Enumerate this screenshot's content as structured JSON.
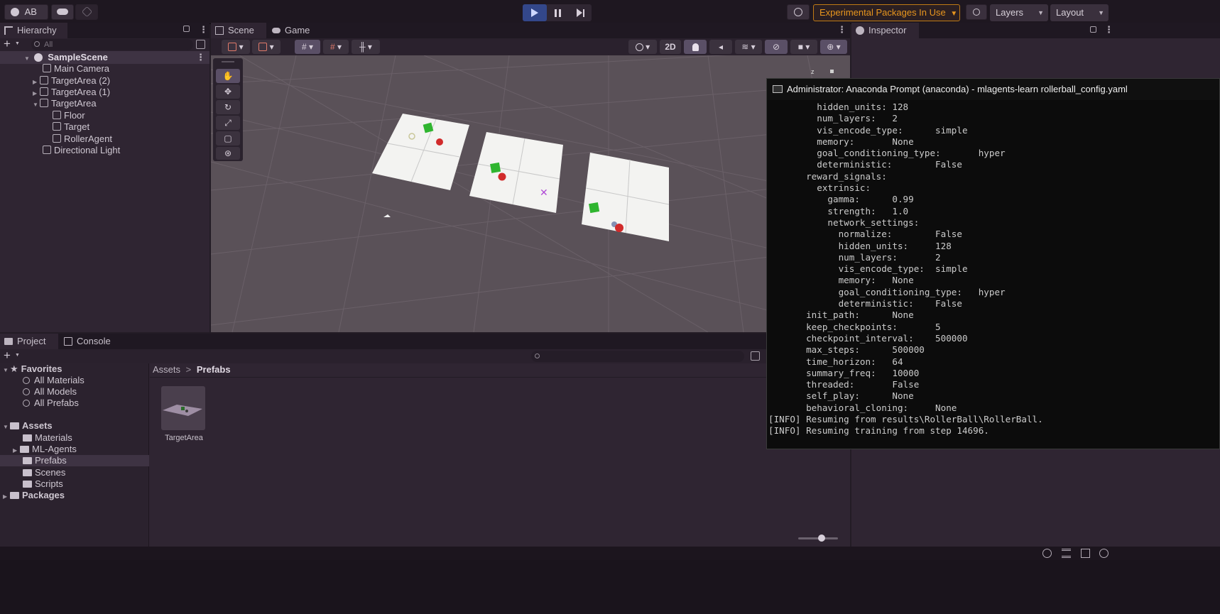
{
  "topbar": {
    "account_label": "AB",
    "experimental_label": "Experimental Packages In Use",
    "layers_label": "Layers",
    "layout_label": "Layout"
  },
  "hierarchy": {
    "tab_label": "Hierarchy",
    "search_placeholder": "All",
    "scene_name": "SampleScene",
    "items": [
      {
        "label": "Main Camera"
      },
      {
        "label": "TargetArea (2)"
      },
      {
        "label": "TargetArea (1)"
      },
      {
        "label": "TargetArea"
      },
      {
        "label": "Floor"
      },
      {
        "label": "Target"
      },
      {
        "label": "RollerAgent"
      },
      {
        "label": "Directional Light"
      }
    ]
  },
  "scene": {
    "tab_scene": "Scene",
    "tab_game": "Game",
    "mode_2d": "2D",
    "gizmo_axis": "z"
  },
  "inspector": {
    "tab_label": "Inspector"
  },
  "terminal": {
    "title": "Administrator: Anaconda Prompt (anaconda) - mlagents-learn  rollerball_config.yaml",
    "lines": [
      "         hidden_units: 128",
      "         num_layers:   2",
      "         vis_encode_type:      simple",
      "         memory:       None",
      "         goal_conditioning_type:       hyper",
      "         deterministic:        False",
      "       reward_signals:",
      "         extrinsic:",
      "           gamma:      0.99",
      "           strength:   1.0",
      "           network_settings:",
      "             normalize:        False",
      "             hidden_units:     128",
      "             num_layers:       2",
      "             vis_encode_type:  simple",
      "             memory:   None",
      "             goal_conditioning_type:   hyper",
      "             deterministic:    False",
      "       init_path:      None",
      "       keep_checkpoints:       5",
      "       checkpoint_interval:    500000",
      "       max_steps:      500000",
      "       time_horizon:   64",
      "       summary_freq:   10000",
      "       threaded:       False",
      "       self_play:      None",
      "       behavioral_cloning:     None",
      "[INFO] Resuming from results\\RollerBall\\RollerBall.",
      "[INFO] Resuming training from step 14696."
    ]
  },
  "project": {
    "tab_project": "Project",
    "tab_console": "Console",
    "favorites_label": "Favorites",
    "favorites": [
      "All Materials",
      "All Models",
      "All Prefabs"
    ],
    "assets_label": "Assets",
    "assets": [
      "Materials",
      "ML-Agents",
      "Prefabs",
      "Scenes",
      "Scripts"
    ],
    "packages_label": "Packages",
    "breadcrumb_root": "Assets",
    "breadcrumb_current": "Prefabs",
    "asset_tile_label": "TargetArea"
  },
  "colors": {
    "accent_orange": "#e8961e",
    "selection": "#3e3343",
    "scene_bg": "#5a5158"
  }
}
